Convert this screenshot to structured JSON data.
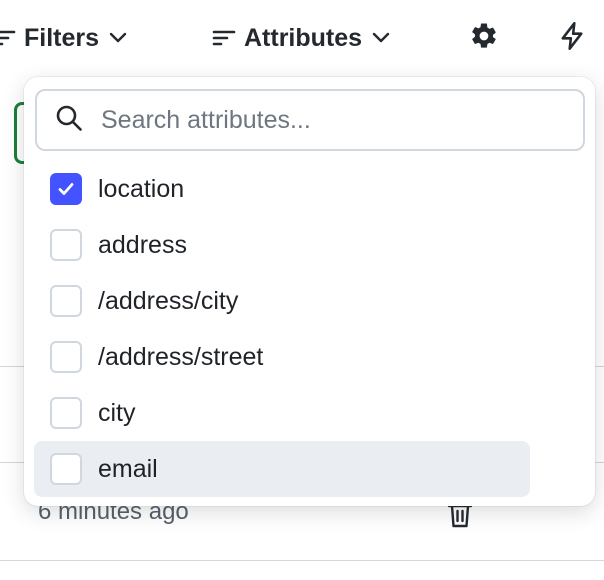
{
  "toolbar": {
    "filters_label": "Filters",
    "attributes_label": "Attributes"
  },
  "dropdown": {
    "search_placeholder": "Search attributes...",
    "search_value": "",
    "options": [
      {
        "label": "location",
        "checked": true
      },
      {
        "label": "address",
        "checked": false
      },
      {
        "label": "/address/city",
        "checked": false
      },
      {
        "label": "/address/street",
        "checked": false
      },
      {
        "label": "city",
        "checked": false
      },
      {
        "label": "email",
        "checked": false,
        "hovered": true
      }
    ]
  },
  "background": {
    "row_time": "6 minutes ago"
  },
  "colors": {
    "accent": "#4353ff",
    "success_border": "#1a7f37",
    "hover_bg": "#eaeef2"
  },
  "icons": [
    "sort-icon",
    "chevron-down-icon",
    "gear-icon",
    "bolt-icon",
    "search-icon",
    "check-icon",
    "trash-icon"
  ]
}
